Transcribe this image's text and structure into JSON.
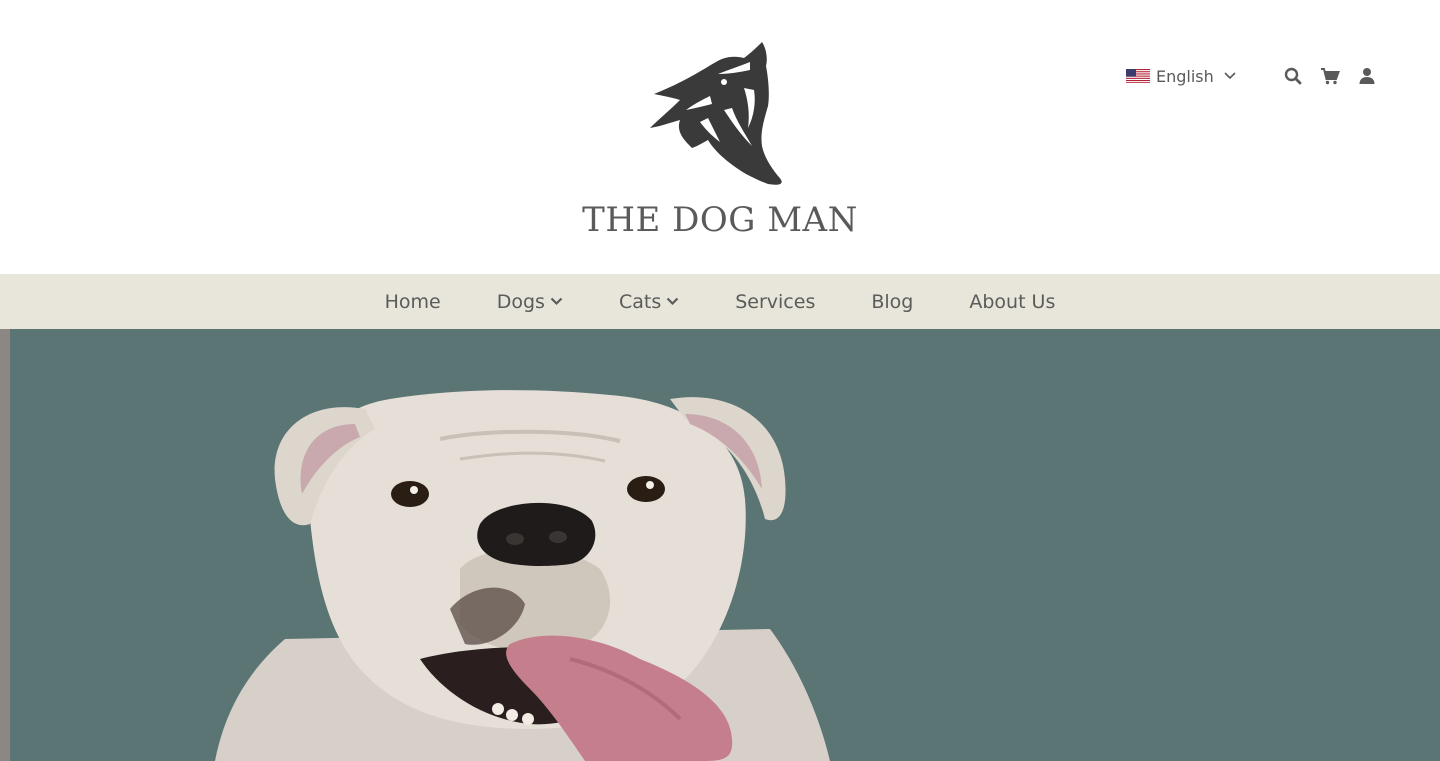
{
  "brand": {
    "name": "THE DOG MAN",
    "logo_icon": "howling-wolf-icon"
  },
  "language": {
    "selected": "English",
    "flag_icon": "us-flag-icon",
    "chevron_icon": "chevron-down-icon"
  },
  "utility_icons": [
    "search-icon",
    "cart-icon",
    "user-icon"
  ],
  "nav": {
    "items": [
      {
        "label": "Home",
        "dropdown": false
      },
      {
        "label": "Dogs",
        "dropdown": true
      },
      {
        "label": "Cats",
        "dropdown": true
      },
      {
        "label": "Services",
        "dropdown": false
      },
      {
        "label": "Blog",
        "dropdown": false
      },
      {
        "label": "About Us",
        "dropdown": false
      }
    ]
  },
  "hero": {
    "image": "bulldog-photo",
    "background_color": "#5b7574"
  },
  "colors": {
    "nav_background": "#e8e5da",
    "text": "#5b5b5b",
    "hero_background": "#5b7574"
  }
}
